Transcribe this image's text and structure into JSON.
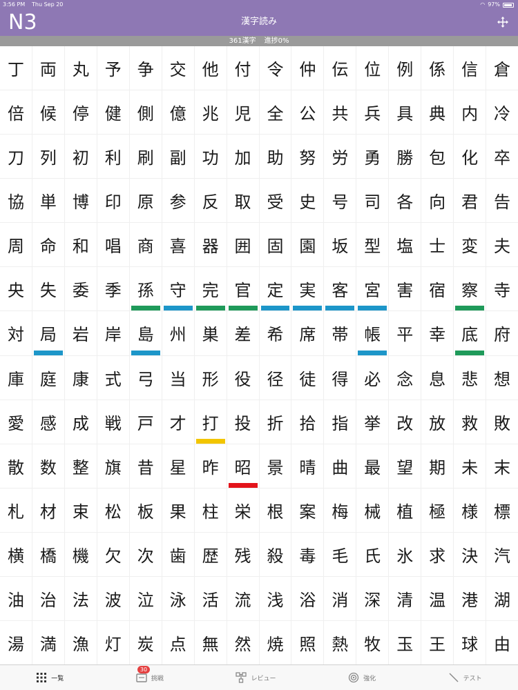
{
  "status_bar": {
    "time": "3:56 PM",
    "date": "Thu Sep 20",
    "battery": "97%"
  },
  "header": {
    "level": "N3",
    "title": "漢字読み"
  },
  "progress": {
    "count_label": "361漢字",
    "progress_label": "進捗0%"
  },
  "colors": {
    "header_bg": "#8e78b4",
    "green": "#1f9a5a",
    "blue": "#1d96c9",
    "yellow": "#f2c500",
    "red": "#e3141b"
  },
  "kanji_rows": [
    [
      "丁",
      "両",
      "丸",
      "予",
      "争",
      "交",
      "他",
      "付",
      "令",
      "仲",
      "伝",
      "位",
      "例",
      "係",
      "信",
      "倉"
    ],
    [
      "倍",
      "候",
      "停",
      "健",
      "側",
      "億",
      "兆",
      "児",
      "全",
      "公",
      "共",
      "兵",
      "具",
      "典",
      "内",
      "冷"
    ],
    [
      "刀",
      "列",
      "初",
      "利",
      "刷",
      "副",
      "功",
      "加",
      "助",
      "努",
      "労",
      "勇",
      "勝",
      "包",
      "化",
      "卒"
    ],
    [
      "協",
      "単",
      "博",
      "印",
      "原",
      "参",
      "反",
      "取",
      "受",
      "史",
      "号",
      "司",
      "各",
      "向",
      "君",
      "告"
    ],
    [
      "周",
      "命",
      "和",
      "唱",
      "商",
      "喜",
      "器",
      "囲",
      "固",
      "園",
      "坂",
      "型",
      "塩",
      "士",
      "変",
      "夫"
    ],
    [
      "央",
      "失",
      "委",
      "季",
      "孫",
      "守",
      "完",
      "官",
      "定",
      "実",
      "客",
      "宮",
      "害",
      "宿",
      "察",
      "寺"
    ],
    [
      "対",
      "局",
      "岩",
      "岸",
      "島",
      "州",
      "巣",
      "差",
      "希",
      "席",
      "帯",
      "帳",
      "平",
      "幸",
      "底",
      "府"
    ],
    [
      "庫",
      "庭",
      "康",
      "式",
      "弓",
      "当",
      "形",
      "役",
      "径",
      "徒",
      "得",
      "必",
      "念",
      "息",
      "悲",
      "想"
    ],
    [
      "愛",
      "感",
      "成",
      "戦",
      "戸",
      "才",
      "打",
      "投",
      "折",
      "拾",
      "指",
      "挙",
      "改",
      "放",
      "救",
      "敗"
    ],
    [
      "散",
      "数",
      "整",
      "旗",
      "昔",
      "星",
      "昨",
      "昭",
      "景",
      "晴",
      "曲",
      "最",
      "望",
      "期",
      "未",
      "末"
    ],
    [
      "札",
      "材",
      "束",
      "松",
      "板",
      "果",
      "柱",
      "栄",
      "根",
      "案",
      "梅",
      "械",
      "植",
      "極",
      "様",
      "標"
    ],
    [
      "横",
      "橋",
      "機",
      "欠",
      "次",
      "歯",
      "歴",
      "残",
      "殺",
      "毒",
      "毛",
      "氏",
      "氷",
      "求",
      "決",
      "汽"
    ],
    [
      "油",
      "治",
      "法",
      "波",
      "泣",
      "泳",
      "活",
      "流",
      "浅",
      "浴",
      "消",
      "深",
      "清",
      "温",
      "港",
      "湖"
    ],
    [
      "湯",
      "満",
      "漁",
      "灯",
      "炭",
      "点",
      "無",
      "然",
      "焼",
      "照",
      "熱",
      "牧",
      "玉",
      "王",
      "球",
      "由"
    ]
  ],
  "marks": [
    {
      "row": 5,
      "col": 4,
      "color": "green"
    },
    {
      "row": 5,
      "col": 5,
      "color": "blue"
    },
    {
      "row": 5,
      "col": 6,
      "color": "green"
    },
    {
      "row": 5,
      "col": 7,
      "color": "green"
    },
    {
      "row": 5,
      "col": 8,
      "color": "blue"
    },
    {
      "row": 5,
      "col": 9,
      "color": "blue"
    },
    {
      "row": 5,
      "col": 10,
      "color": "blue"
    },
    {
      "row": 5,
      "col": 11,
      "color": "blue"
    },
    {
      "row": 5,
      "col": 14,
      "color": "green"
    },
    {
      "row": 6,
      "col": 1,
      "color": "blue"
    },
    {
      "row": 6,
      "col": 4,
      "color": "blue"
    },
    {
      "row": 6,
      "col": 11,
      "color": "blue"
    },
    {
      "row": 6,
      "col": 14,
      "color": "green"
    },
    {
      "row": 8,
      "col": 6,
      "color": "yellow"
    },
    {
      "row": 9,
      "col": 7,
      "color": "red"
    }
  ],
  "tabs": [
    {
      "label": "一覧",
      "icon": "grid-icon",
      "active": true
    },
    {
      "label": "挑戦",
      "icon": "challenge-icon",
      "badge": "30"
    },
    {
      "label": "レビュー",
      "icon": "review-icon"
    },
    {
      "label": "強化",
      "icon": "target-icon"
    },
    {
      "label": "テスト",
      "icon": "pencil-icon"
    }
  ]
}
